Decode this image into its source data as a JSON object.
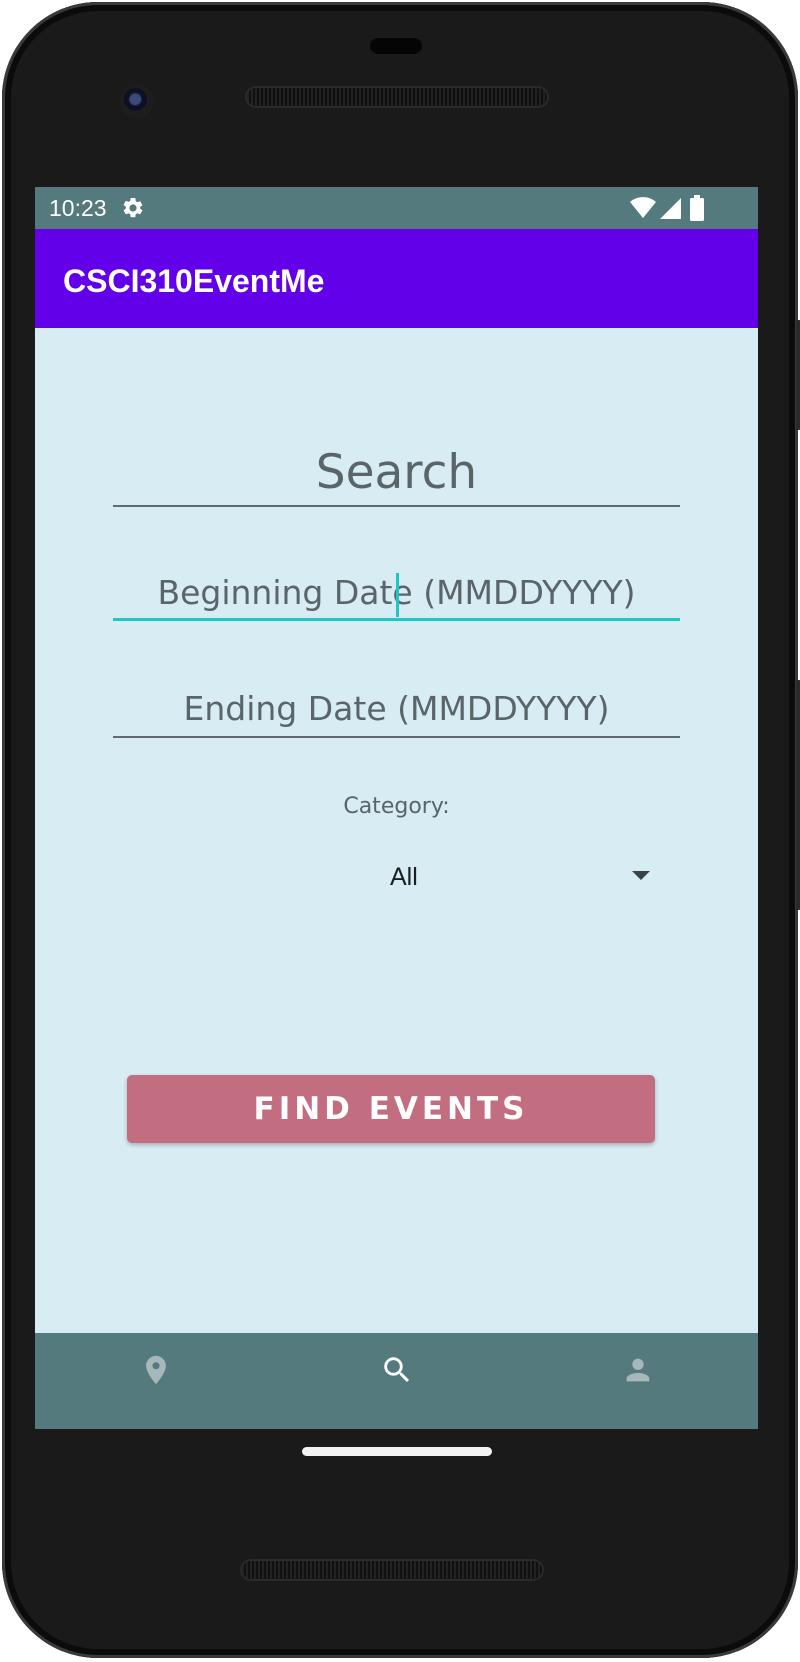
{
  "status_bar": {
    "time": "10:23",
    "icons": [
      "gear-icon",
      "wifi-icon",
      "signal-icon",
      "battery-icon"
    ]
  },
  "app_bar": {
    "title": "CSCI310EventMe",
    "color": "#6200ea"
  },
  "form": {
    "search_placeholder": "Search",
    "begin_date_placeholder": "Beginning Date (MMDDYYYY)",
    "end_date_placeholder": "Ending Date (MMDDYYYY)",
    "category_label": "Category:",
    "category_selected": "All",
    "submit_label": "FIND EVENTS",
    "focused_field": "begin_date"
  },
  "bottom_nav": {
    "items": [
      {
        "icon": "map-pin-icon",
        "active": false
      },
      {
        "icon": "search-icon",
        "active": true
      },
      {
        "icon": "person-icon",
        "active": false
      }
    ],
    "background": "#557a7e"
  },
  "colors": {
    "screen_background": "#d8ecf3",
    "accent": "#1ec8c0",
    "button": "#c26d80"
  }
}
